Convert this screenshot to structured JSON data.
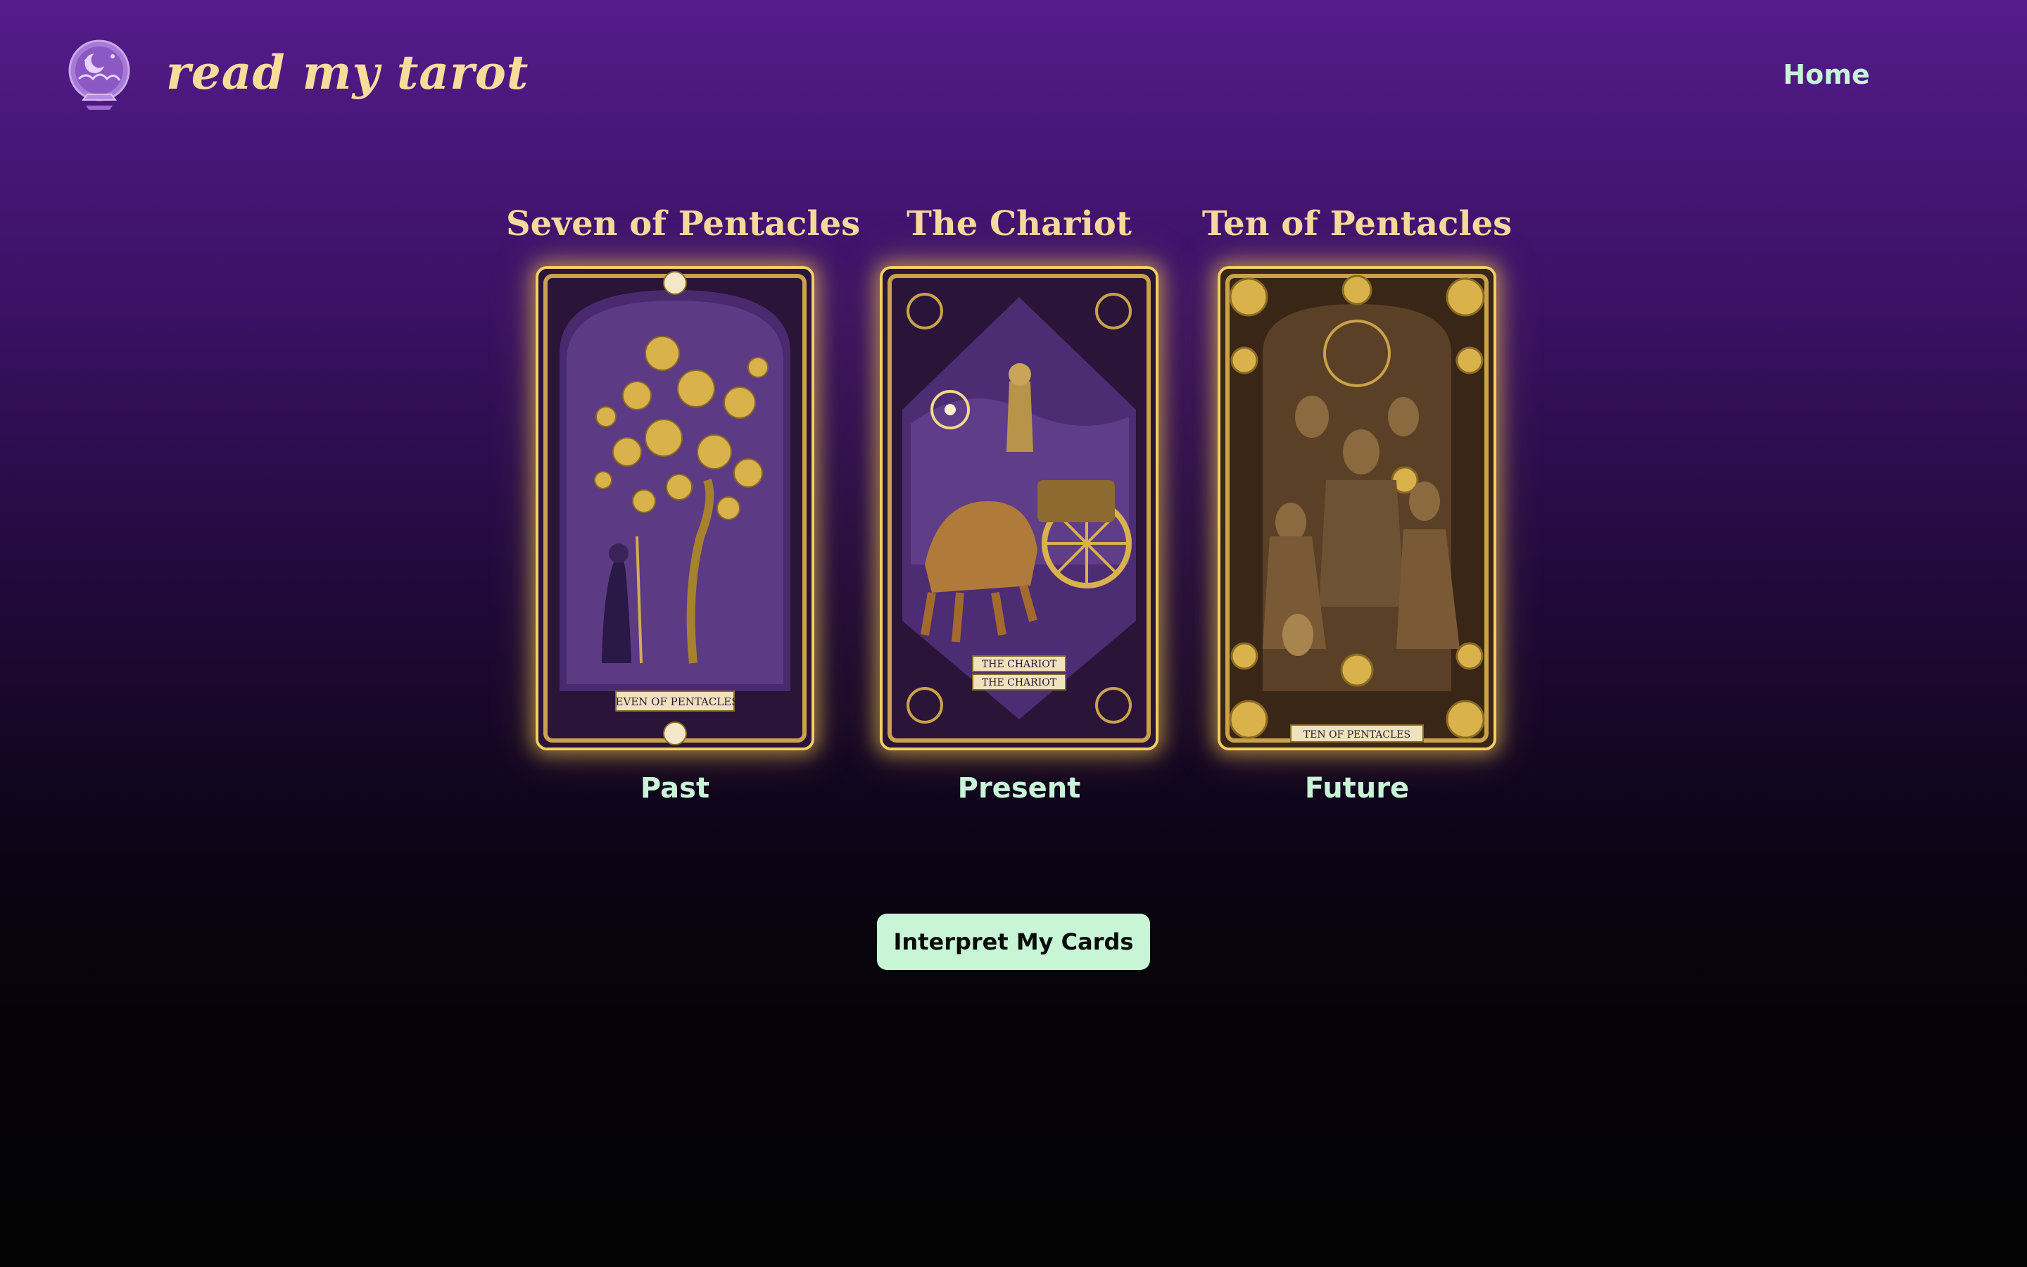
{
  "app": {
    "brand_name": "read my tarot",
    "logo_icon": "crystal-ball-icon"
  },
  "nav": {
    "home_label": "Home"
  },
  "spread": {
    "cards": [
      {
        "title": "Seven of Pentacles",
        "position": "Past",
        "banner": "SEVEN OF PENTACLES."
      },
      {
        "title": "The Chariot",
        "position": "Present",
        "banner": "THE CHARIOT"
      },
      {
        "title": "Ten of Pentacles",
        "position": "Future",
        "banner": "TEN OF PENTACLES"
      }
    ]
  },
  "actions": {
    "interpret_label": "Interpret My Cards"
  },
  "colors": {
    "accent_gold": "#f2cf5f",
    "title_gold": "#f7d99c",
    "mint": "#c8f4d8",
    "bg_top": "#541c8a",
    "bg_bottom": "#040304"
  }
}
